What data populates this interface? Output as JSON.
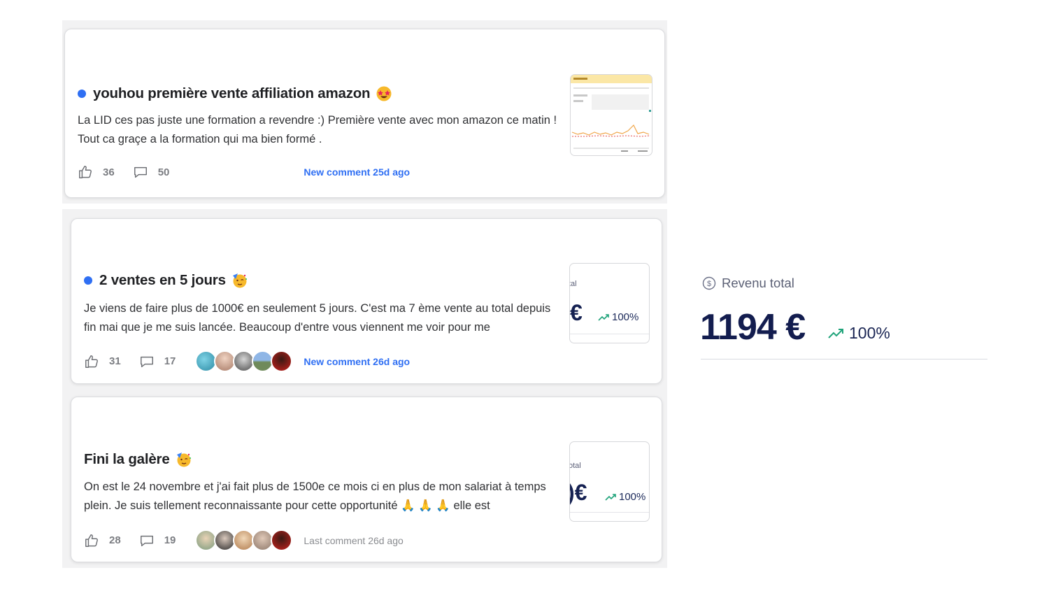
{
  "posts": [
    {
      "title": "youhou première vente affiliation amazon",
      "body": "La LID ces pas juste une formation a revendre :) Première vente avec mon amazon ce matin ! Tout ca graçe a la formation qui ma bien formé .",
      "likes": "36",
      "comments": "50",
      "activity": "New comment 25d ago",
      "unread": true,
      "emoji": "star-struck-emoji"
    },
    {
      "title": "2 ventes en 5 jours",
      "body": "Je viens de faire plus de 1000€ en seulement 5 jours. C'est ma 7 ème vente au total depuis fin mai que je me suis lancée. Beaucoup d'entre vous viennent me voir pour me",
      "likes": "31",
      "comments": "17",
      "activity": "New comment 26d ago",
      "unread": true,
      "emoji": "partying-face-emoji",
      "thumb": {
        "label": "tal",
        "value": "€",
        "pct": "100%"
      }
    },
    {
      "title": "Fini la galère",
      "body": "On est le 24 novembre et j'ai fait plus de 1500e ce mois ci en plus de mon salariat à temps plein. Je suis tellement reconnaissante pour cette opportunité 🙏 🙏 🙏 elle est",
      "likes": "28",
      "comments": "19",
      "activity": "Last comment 26d ago",
      "unread": false,
      "emoji": "partying-face-emoji",
      "thumb": {
        "label": "otal",
        "value": ")€",
        "pct": "100%"
      }
    }
  ],
  "revenue": {
    "icon": "dollar-circle-icon",
    "label": "Revenu total",
    "value": "1194 €",
    "trend_icon": "trending-up-icon",
    "change": "100%"
  },
  "colors": {
    "accent": "#2f6ff3",
    "navy": "#131d4f",
    "trend_green": "#1fa37a",
    "panel": "#f2f2f3"
  }
}
